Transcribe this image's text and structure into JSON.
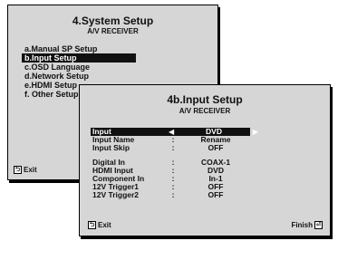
{
  "system_setup": {
    "title": "4.System Setup",
    "subtitle": "A/V RECEIVER",
    "items": [
      {
        "label": "a.Manual SP Setup",
        "selected": false
      },
      {
        "label": "b.Input Setup",
        "selected": true
      },
      {
        "label": "c.OSD Language",
        "selected": false
      },
      {
        "label": "d.Network Setup",
        "selected": false
      },
      {
        "label": "e.HDMI Setup",
        "selected": false
      },
      {
        "label": "f. Other Setup",
        "selected": false
      }
    ],
    "exit_label": "Exit"
  },
  "input_setup": {
    "title": "4b.Input Setup",
    "subtitle": "A/V RECEIVER",
    "rows": [
      {
        "label": "Input",
        "colon": ":",
        "value": "DVD",
        "selected": true
      },
      {
        "label": "Input Name",
        "colon": ":",
        "value": "Rename"
      },
      {
        "label": "Input Skip",
        "colon": ":",
        "value": "OFF"
      },
      {
        "label": "Digital In",
        "colon": ":",
        "value": "COAX-1"
      },
      {
        "label": "HDMI Input",
        "colon": ":",
        "value": "DVD"
      },
      {
        "label": "Component In",
        "colon": ":",
        "value": "In-1"
      },
      {
        "label": "12V Trigger1",
        "colon": ":",
        "value": "OFF"
      },
      {
        "label": "12V Trigger2",
        "colon": ":",
        "value": "OFF"
      }
    ],
    "exit_label": "Exit",
    "finish_label": "Finish"
  },
  "icons": {
    "exit_key": "return-key-icon",
    "finish_key": "enter-key-icon",
    "left_arrow": "left-arrow-icon",
    "right_arrow": "right-arrow-icon"
  }
}
